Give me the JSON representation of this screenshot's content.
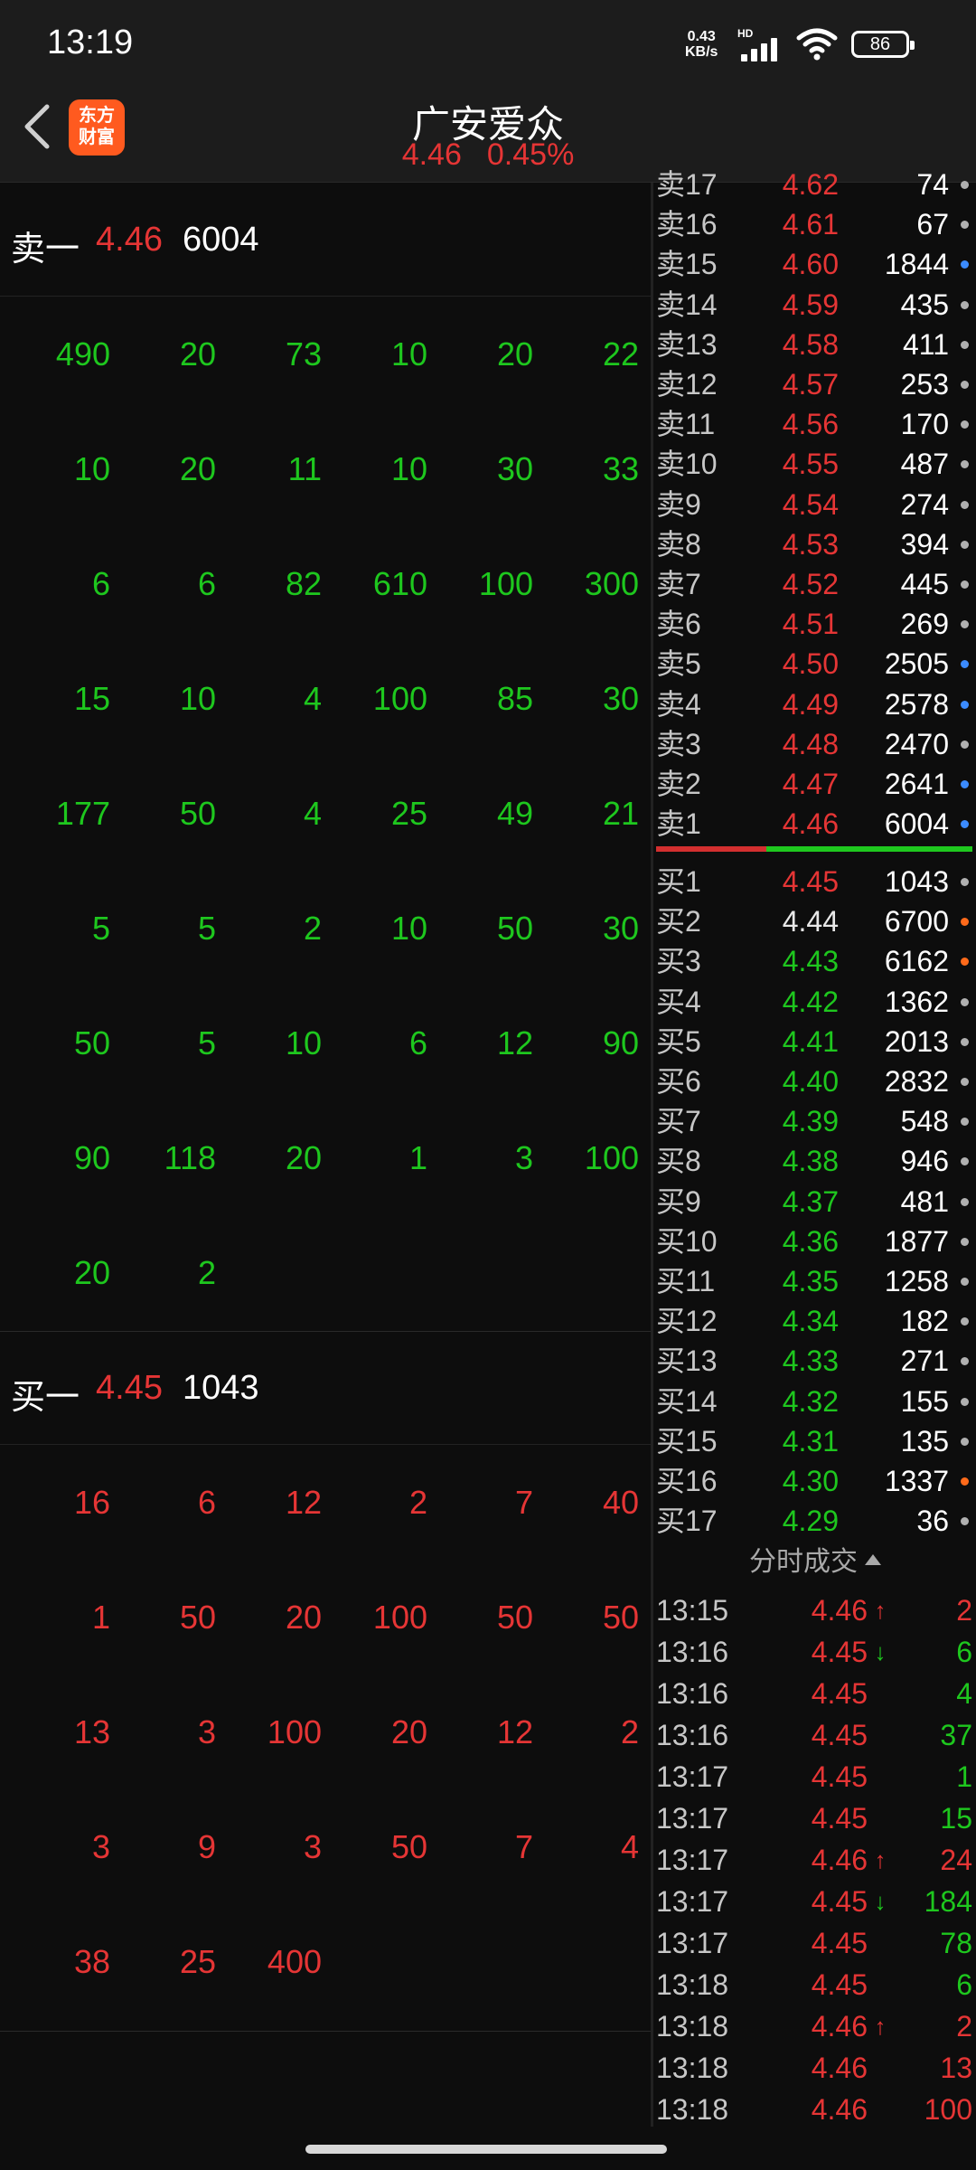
{
  "status": {
    "time": "13:19",
    "net_speed": "0.43",
    "net_unit": "KB/s",
    "hd": "HD",
    "battery": "86"
  },
  "header": {
    "logo_line1": "东方",
    "logo_line2": "财富",
    "name": "广安爱众",
    "price": "4.46",
    "change_pct": "0.45%"
  },
  "sell_block": {
    "label": "卖一",
    "price": "4.46",
    "qty": "6004",
    "orders": [
      [
        "490",
        "20",
        "73",
        "10",
        "20",
        "22"
      ],
      [
        "10",
        "20",
        "11",
        "10",
        "30",
        "33"
      ],
      [
        "6",
        "6",
        "82",
        "610",
        "100",
        "300"
      ],
      [
        "15",
        "10",
        "4",
        "100",
        "85",
        "30"
      ],
      [
        "177",
        "50",
        "4",
        "25",
        "49",
        "21"
      ],
      [
        "5",
        "5",
        "2",
        "10",
        "50",
        "30"
      ],
      [
        "50",
        "5",
        "10",
        "6",
        "12",
        "90"
      ],
      [
        "90",
        "118",
        "20",
        "1",
        "3",
        "100"
      ],
      [
        "20",
        "2"
      ]
    ]
  },
  "buy_block": {
    "label": "买一",
    "price": "4.45",
    "qty": "1043",
    "orders": [
      [
        "16",
        "6",
        "12",
        "2",
        "7",
        "40"
      ],
      [
        "1",
        "50",
        "20",
        "100",
        "50",
        "50"
      ],
      [
        "13",
        "3",
        "100",
        "20",
        "12",
        "2"
      ],
      [
        "3",
        "9",
        "3",
        "50",
        "7",
        "4"
      ],
      [
        "38",
        "25",
        "400"
      ]
    ]
  },
  "order_book": {
    "asks": [
      {
        "label": "卖17",
        "price": "4.62",
        "qty": "74",
        "dot": "grey"
      },
      {
        "label": "卖16",
        "price": "4.61",
        "qty": "67",
        "dot": "grey"
      },
      {
        "label": "卖15",
        "price": "4.60",
        "qty": "1844",
        "dot": "blue"
      },
      {
        "label": "卖14",
        "price": "4.59",
        "qty": "435",
        "dot": "grey"
      },
      {
        "label": "卖13",
        "price": "4.58",
        "qty": "411",
        "dot": "grey"
      },
      {
        "label": "卖12",
        "price": "4.57",
        "qty": "253",
        "dot": "grey"
      },
      {
        "label": "卖11",
        "price": "4.56",
        "qty": "170",
        "dot": "grey"
      },
      {
        "label": "卖10",
        "price": "4.55",
        "qty": "487",
        "dot": "grey"
      },
      {
        "label": "卖9",
        "price": "4.54",
        "qty": "274",
        "dot": "grey"
      },
      {
        "label": "卖8",
        "price": "4.53",
        "qty": "394",
        "dot": "grey"
      },
      {
        "label": "卖7",
        "price": "4.52",
        "qty": "445",
        "dot": "grey"
      },
      {
        "label": "卖6",
        "price": "4.51",
        "qty": "269",
        "dot": "grey"
      },
      {
        "label": "卖5",
        "price": "4.50",
        "qty": "2505",
        "dot": "blue"
      },
      {
        "label": "卖4",
        "price": "4.49",
        "qty": "2578",
        "dot": "blue"
      },
      {
        "label": "卖3",
        "price": "4.48",
        "qty": "2470",
        "dot": "grey"
      },
      {
        "label": "卖2",
        "price": "4.47",
        "qty": "2641",
        "dot": "blue"
      },
      {
        "label": "卖1",
        "price": "4.46",
        "qty": "6004",
        "dot": "blue"
      }
    ],
    "bids": [
      {
        "label": "买1",
        "price": "4.45",
        "qty": "1043",
        "dot": "grey",
        "color": "red"
      },
      {
        "label": "买2",
        "price": "4.44",
        "qty": "6700",
        "dot": "orange",
        "color": "white"
      },
      {
        "label": "买3",
        "price": "4.43",
        "qty": "6162",
        "dot": "orange",
        "color": "green"
      },
      {
        "label": "买4",
        "price": "4.42",
        "qty": "1362",
        "dot": "grey",
        "color": "green"
      },
      {
        "label": "买5",
        "price": "4.41",
        "qty": "2013",
        "dot": "grey",
        "color": "green"
      },
      {
        "label": "买6",
        "price": "4.40",
        "qty": "2832",
        "dot": "grey",
        "color": "green"
      },
      {
        "label": "买7",
        "price": "4.39",
        "qty": "548",
        "dot": "grey",
        "color": "green"
      },
      {
        "label": "买8",
        "price": "4.38",
        "qty": "946",
        "dot": "grey",
        "color": "green"
      },
      {
        "label": "买9",
        "price": "4.37",
        "qty": "481",
        "dot": "grey",
        "color": "green"
      },
      {
        "label": "买10",
        "price": "4.36",
        "qty": "1877",
        "dot": "grey",
        "color": "green"
      },
      {
        "label": "买11",
        "price": "4.35",
        "qty": "1258",
        "dot": "grey",
        "color": "green"
      },
      {
        "label": "买12",
        "price": "4.34",
        "qty": "182",
        "dot": "grey",
        "color": "green"
      },
      {
        "label": "买13",
        "price": "4.33",
        "qty": "271",
        "dot": "grey",
        "color": "green"
      },
      {
        "label": "买14",
        "price": "4.32",
        "qty": "155",
        "dot": "grey",
        "color": "green"
      },
      {
        "label": "买15",
        "price": "4.31",
        "qty": "135",
        "dot": "grey",
        "color": "green"
      },
      {
        "label": "买16",
        "price": "4.30",
        "qty": "1337",
        "dot": "orange",
        "color": "green"
      },
      {
        "label": "买17",
        "price": "4.29",
        "qty": "36",
        "dot": "grey",
        "color": "green"
      }
    ]
  },
  "time_sales": {
    "title": "分时成交",
    "rows": [
      {
        "time": "13:15",
        "price": "4.46",
        "arrow": "↑",
        "vol": "2",
        "vol_color": "red"
      },
      {
        "time": "13:16",
        "price": "4.45",
        "arrow": "↓",
        "vol": "6",
        "vol_color": "green"
      },
      {
        "time": "13:16",
        "price": "4.45",
        "arrow": "",
        "vol": "4",
        "vol_color": "green"
      },
      {
        "time": "13:16",
        "price": "4.45",
        "arrow": "",
        "vol": "37",
        "vol_color": "green"
      },
      {
        "time": "13:17",
        "price": "4.45",
        "arrow": "",
        "vol": "1",
        "vol_color": "green"
      },
      {
        "time": "13:17",
        "price": "4.45",
        "arrow": "",
        "vol": "15",
        "vol_color": "green"
      },
      {
        "time": "13:17",
        "price": "4.46",
        "arrow": "↑",
        "vol": "24",
        "vol_color": "red"
      },
      {
        "time": "13:17",
        "price": "4.45",
        "arrow": "↓",
        "vol": "184",
        "vol_color": "green"
      },
      {
        "time": "13:17",
        "price": "4.45",
        "arrow": "",
        "vol": "78",
        "vol_color": "green"
      },
      {
        "time": "13:18",
        "price": "4.45",
        "arrow": "",
        "vol": "6",
        "vol_color": "green"
      },
      {
        "time": "13:18",
        "price": "4.46",
        "arrow": "↑",
        "vol": "2",
        "vol_color": "red"
      },
      {
        "time": "13:18",
        "price": "4.46",
        "arrow": "",
        "vol": "13",
        "vol_color": "red"
      },
      {
        "time": "13:18",
        "price": "4.46",
        "arrow": "",
        "vol": "100",
        "vol_color": "red"
      }
    ]
  },
  "colors": {
    "up": "#e53535",
    "down": "#1ec71e",
    "accent": "#ff5a1f"
  }
}
